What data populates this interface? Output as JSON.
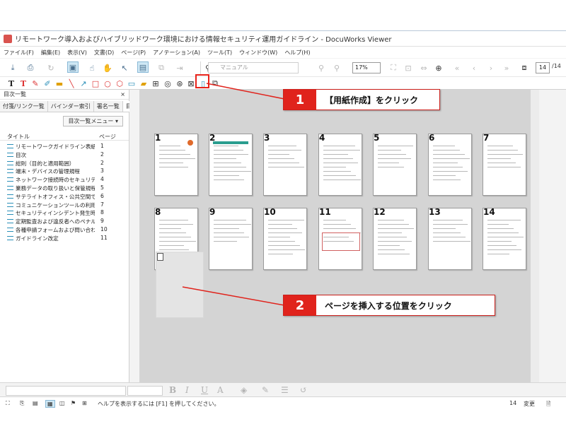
{
  "window": {
    "title": "リモートワーク導入およびハイブリッドワーク環境における情報セキュリティ運用ガイドライン - DocuWorks Viewer"
  },
  "menu": [
    "ファイル(F)",
    "編集(E)",
    "表示(V)",
    "文書(D)",
    "ページ(P)",
    "アノテーション(A)",
    "ツール(T)",
    "ウィンドウ(W)",
    "ヘルプ(H)"
  ],
  "toolbar": {
    "search_placeholder": "マニュアル",
    "zoom": "17%",
    "page_current": "14",
    "page_total": "/14"
  },
  "left_pane": {
    "title": "目次一覧",
    "tabs": [
      "付箋/リンク一覧",
      "バインダー索引",
      "署名一覧",
      "目次"
    ],
    "menu_button": "目次一覧メニュー",
    "col_title": "タイトル",
    "col_page": "ページ",
    "items": [
      {
        "title": "リモートワークガイドライン表紙",
        "page": "1"
      },
      {
        "title": "目次",
        "page": "2"
      },
      {
        "title": "総則（目的と適用範囲）",
        "page": "2"
      },
      {
        "title": "端末・デバイスの管理規程",
        "page": "3"
      },
      {
        "title": "ネットワーク接続時のセキュリティルール",
        "page": "4"
      },
      {
        "title": "業務データの取り扱いと保管規程",
        "page": "5"
      },
      {
        "title": "サテライトオフィス・公共空間での業…",
        "page": "6"
      },
      {
        "title": "コミュニケーションツールの利用制限",
        "page": "7"
      },
      {
        "title": "セキュリティインシデント発生時の初…",
        "page": "8"
      },
      {
        "title": "定期監査および違反者へのペナルティ",
        "page": "9"
      },
      {
        "title": "各種申請フォームおよび問い合わせ先",
        "page": "10"
      },
      {
        "title": "ガイドライン改定",
        "page": "11"
      }
    ]
  },
  "pages": [
    "1",
    "2",
    "3",
    "4",
    "5",
    "6",
    "7",
    "8",
    "9",
    "10",
    "11",
    "12",
    "13",
    "14"
  ],
  "status": {
    "help": "ヘルプを表示するには [F1] を押してください。",
    "page": "14",
    "mode": "変更"
  },
  "callouts": [
    {
      "num": "1",
      "text": "【用紙作成】をクリック"
    },
    {
      "num": "2",
      "text": "ページを挿入する位置をクリック"
    }
  ],
  "colors": {
    "accent_red": "#e0231c",
    "icon_blue": "#2a8fb8",
    "workspace": "#d4d4d4"
  }
}
